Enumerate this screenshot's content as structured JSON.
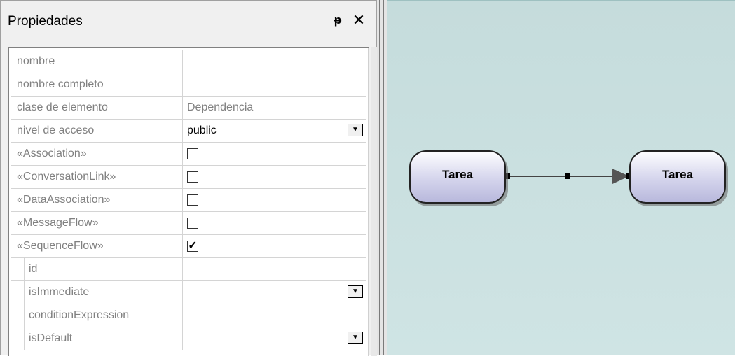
{
  "panel": {
    "title": "Propiedades",
    "pin_glyph": "ᵽ",
    "close_glyph": "✕",
    "rows": [
      {
        "name": "nombre",
        "value": "",
        "type": "text",
        "indent": false
      },
      {
        "name": "nombre completo",
        "value": "",
        "type": "text",
        "indent": false
      },
      {
        "name": "clase de elemento",
        "value": "Dependencia",
        "type": "text",
        "indent": false
      },
      {
        "name": "nivel de acceso",
        "value": "public",
        "type": "dropdown",
        "indent": false
      },
      {
        "name": "«Association»",
        "value": "",
        "type": "checkbox",
        "checked": false,
        "indent": false
      },
      {
        "name": "«ConversationLink»",
        "value": "",
        "type": "checkbox",
        "checked": false,
        "indent": false
      },
      {
        "name": "«DataAssociation»",
        "value": "",
        "type": "checkbox",
        "checked": false,
        "indent": false
      },
      {
        "name": "«MessageFlow»",
        "value": "",
        "type": "checkbox",
        "checked": false,
        "indent": false
      },
      {
        "name": "«SequenceFlow»",
        "value": "",
        "type": "checkbox",
        "checked": true,
        "indent": false
      },
      {
        "name": "id",
        "value": "",
        "type": "text",
        "indent": true
      },
      {
        "name": "isImmediate",
        "value": "",
        "type": "dropdown",
        "indent": true
      },
      {
        "name": "conditionExpression",
        "value": "",
        "type": "text",
        "indent": true
      },
      {
        "name": "isDefault",
        "value": "",
        "type": "dropdown",
        "indent": true
      }
    ]
  },
  "diagram": {
    "source_task": "Tarea",
    "target_task": "Tarea",
    "canvas_color": "#c8dfdf",
    "node_border": "#222222"
  }
}
